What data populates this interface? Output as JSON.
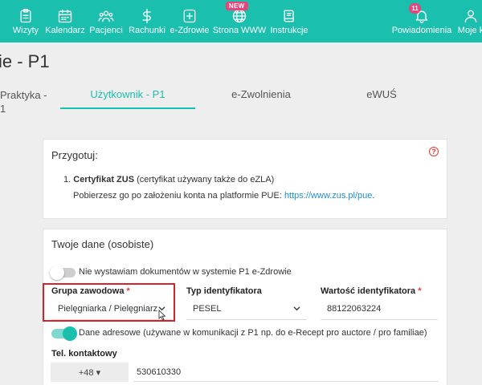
{
  "nav": {
    "items": [
      {
        "label": "Wizyty",
        "icon": "clipboard-icon"
      },
      {
        "label": "Kalendarz",
        "icon": "calendar-icon"
      },
      {
        "label": "Pacjenci",
        "icon": "users-icon"
      },
      {
        "label": "Rachunki",
        "icon": "dollar-icon"
      },
      {
        "label": "e-Zdrowie",
        "icon": "medical-plus-icon"
      },
      {
        "label": "Strona WWW",
        "icon": "globe-icon",
        "badge": "NEW"
      },
      {
        "label": "Instrukcje",
        "icon": "book-icon"
      }
    ],
    "right": [
      {
        "label": "Powiadomienia",
        "icon": "bell-icon",
        "badge": "11"
      },
      {
        "label": "Moje k",
        "icon": "user-icon"
      }
    ]
  },
  "page": {
    "title": "ie - P1"
  },
  "tabs": [
    {
      "label": "Praktyka -",
      "label2": "1"
    },
    {
      "label": "Użytkownik - P1",
      "active": true
    },
    {
      "label": "e-Zwolnienia"
    },
    {
      "label": "eWUŚ"
    }
  ],
  "prepare": {
    "title": "Przygotuj:",
    "item_prefix": "1.",
    "item_bold": "Certyfikat ZUS",
    "item_rest": " (certyfikat używany także do eZLA)",
    "sub_text": "Pobierzesz go po założeniu konta na platformie PUE: ",
    "link": "https://www.zus.pl/pue",
    "link_suffix": "."
  },
  "personal": {
    "title": "Twoje dane (osobiste)",
    "toggle1_label": "Nie wystawiam dokumentów w systemie P1 e-Zdrowie",
    "toggle1_on": false,
    "group_label": "Grupa zawodowa",
    "group_value": "Pielęgniarka / Pielęgniarz",
    "id_type_label": "Typ identyfikatora",
    "id_type_value": "PESEL",
    "id_value_label": "Wartość identyfikatora",
    "id_value": "88122063224",
    "required_mark": "*",
    "toggle2_label": "Dane adresowe (używane w komunikacji z P1 np. do e-Recept pro auctore / pro familiae)",
    "toggle2_on": true,
    "phone_label": "Tel. kontaktowy",
    "phone_prefix": "+48 ▾",
    "phone_value": "530610330"
  },
  "colors": {
    "accent": "#1abfae",
    "badge": "#e8437a",
    "required": "#e53935",
    "highlight": "#d6222a"
  }
}
